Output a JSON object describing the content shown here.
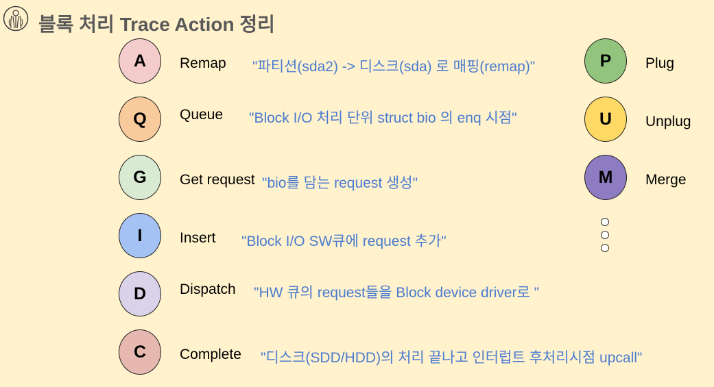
{
  "title": "블록 처리 Trace Action 정리",
  "colors": {
    "background": "#fff2cc",
    "title": "#595959",
    "description": "#4a7bd0"
  },
  "actions": [
    {
      "letter": "A",
      "label": "Remap",
      "description": "\"파티션(sda2) -> 디스크(sda) 로 매핑(remap)\"",
      "color": "#f4cccc"
    },
    {
      "letter": "Q",
      "label": "Queue",
      "description": "\"Block I/O 처리 단위 struct bio 의 enq 시점\"",
      "color": "#f9cb9c"
    },
    {
      "letter": "G",
      "label": "Get request",
      "description": "\"bio를 담는 request 생성\"",
      "color": "#d9ead3"
    },
    {
      "letter": "I",
      "label": "Insert",
      "description": "\"Block I/O SW큐에 request 추가\"",
      "color": "#a4c2f4"
    },
    {
      "letter": "D",
      "label": "Dispatch",
      "description": "\"HW 큐의 request들을 Block device driver로 \"",
      "color": "#d9d2e9"
    },
    {
      "letter": "C",
      "label": "Complete",
      "description": "\"디스크(SDD/HDD)의 처리 끝나고 인터럽트 후처리시점 upcall\"",
      "color": "#e6b8af"
    }
  ],
  "extra_actions": [
    {
      "letter": "P",
      "label": "Plug",
      "color": "#93c47d"
    },
    {
      "letter": "U",
      "label": "Unplug",
      "color": "#ffd966"
    },
    {
      "letter": "M",
      "label": "Merge",
      "color": "#8e7cc3"
    }
  ],
  "ellipsis_icon": "vertical-ellipsis-circles"
}
